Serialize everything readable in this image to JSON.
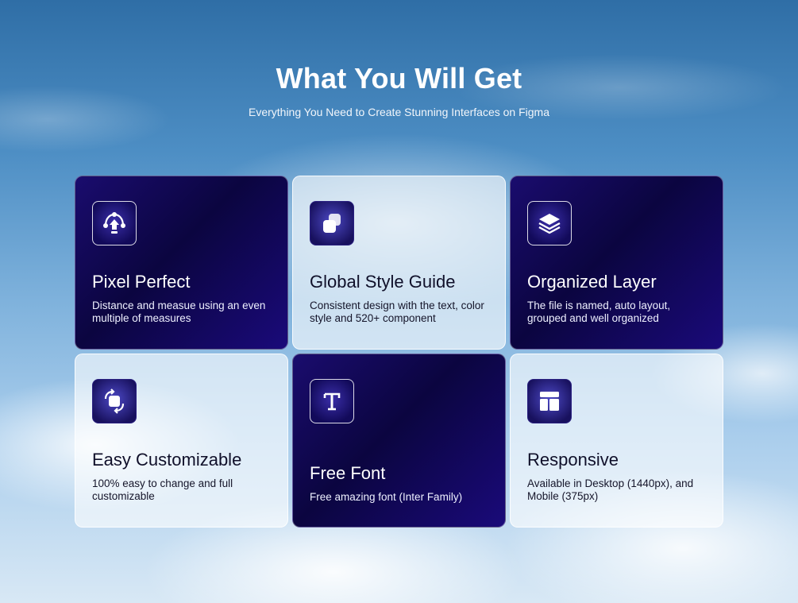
{
  "header": {
    "title": "What You Will Get",
    "subtitle": "Everything You Need to Create Stunning Interfaces on Figma"
  },
  "cards": [
    {
      "title": "Pixel Perfect",
      "description": "Distance and measue using an even multiple of measures",
      "icon": "pen-tool-icon",
      "style": "dark"
    },
    {
      "title": "Global Style Guide",
      "description": "Consistent design with the text, color style and 520+ component",
      "icon": "overlapping-squares-icon",
      "style": "light"
    },
    {
      "title": "Organized Layer",
      "description": "The file is named, auto layout, grouped and well organized",
      "icon": "layers-icon",
      "style": "dark"
    },
    {
      "title": "Easy Customizable",
      "description": "100% easy to change and full customizable",
      "icon": "rotate-square-icon",
      "style": "light"
    },
    {
      "title": "Free Font",
      "description": "Free amazing font (Inter Family)",
      "icon": "text-t-icon",
      "style": "dark"
    },
    {
      "title": "Responsive",
      "description": "Available in Desktop (1440px), and Mobile (375px)",
      "icon": "layout-icon",
      "style": "light"
    }
  ],
  "colors": {
    "dark_card": "#0b0540",
    "accent": "#1a0a7a",
    "text_light": "#ffffff"
  }
}
